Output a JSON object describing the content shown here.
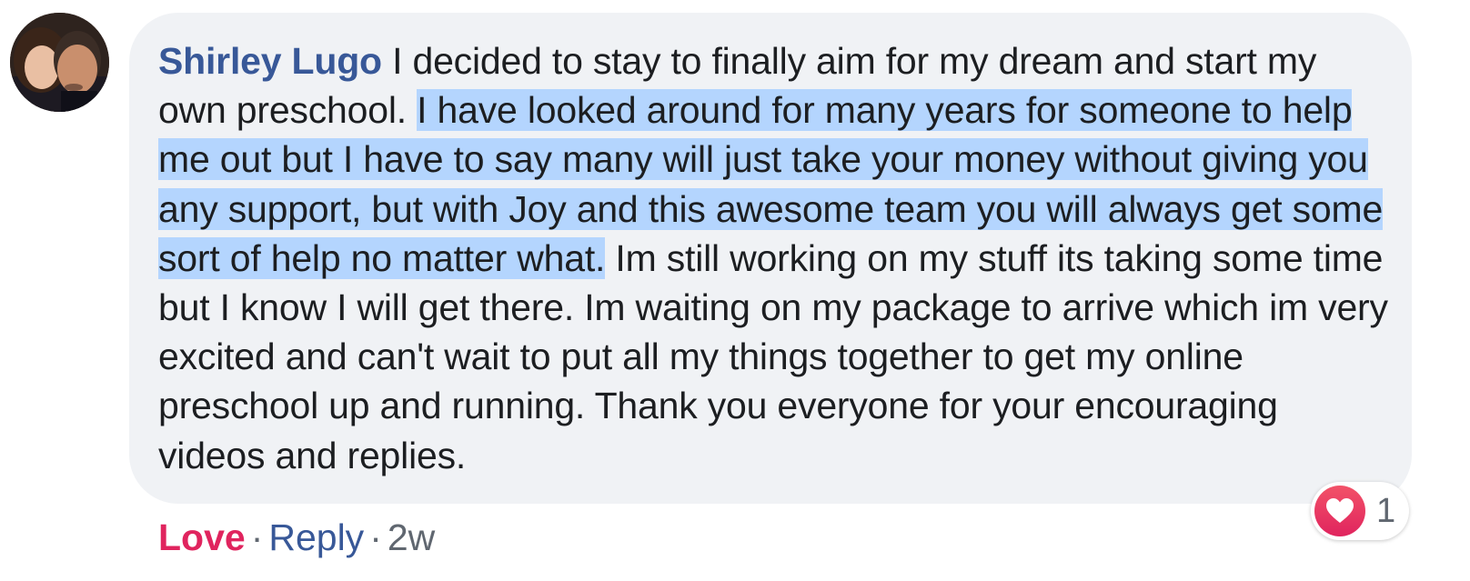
{
  "comment": {
    "author": "Shirley Lugo",
    "text_before_highlight": " I decided to stay to finally aim for my dream and start my own preschool. ",
    "text_highlighted": "I have looked around for many years for someone to help me out but I have to say many will just take your money without giving you any support, but with Joy and this awesome team you will always get some sort of help no matter what.",
    "text_after_highlight": " Im still working on my stuff its taking some time but I know I will get there. Im waiting on my package to arrive which im very excited and can't wait to put all my things together to get my online preschool up and running. Thank you everyone for your encouraging videos and replies."
  },
  "actions": {
    "love_label": "Love",
    "reply_label": "Reply",
    "separator": "·",
    "timestamp": "2w"
  },
  "reactions": {
    "icon": "heart-icon",
    "count": "1"
  },
  "colors": {
    "author": "#385898",
    "love": "#e0245e",
    "highlight": "#b4d5fe",
    "bubble": "#f0f2f5"
  }
}
